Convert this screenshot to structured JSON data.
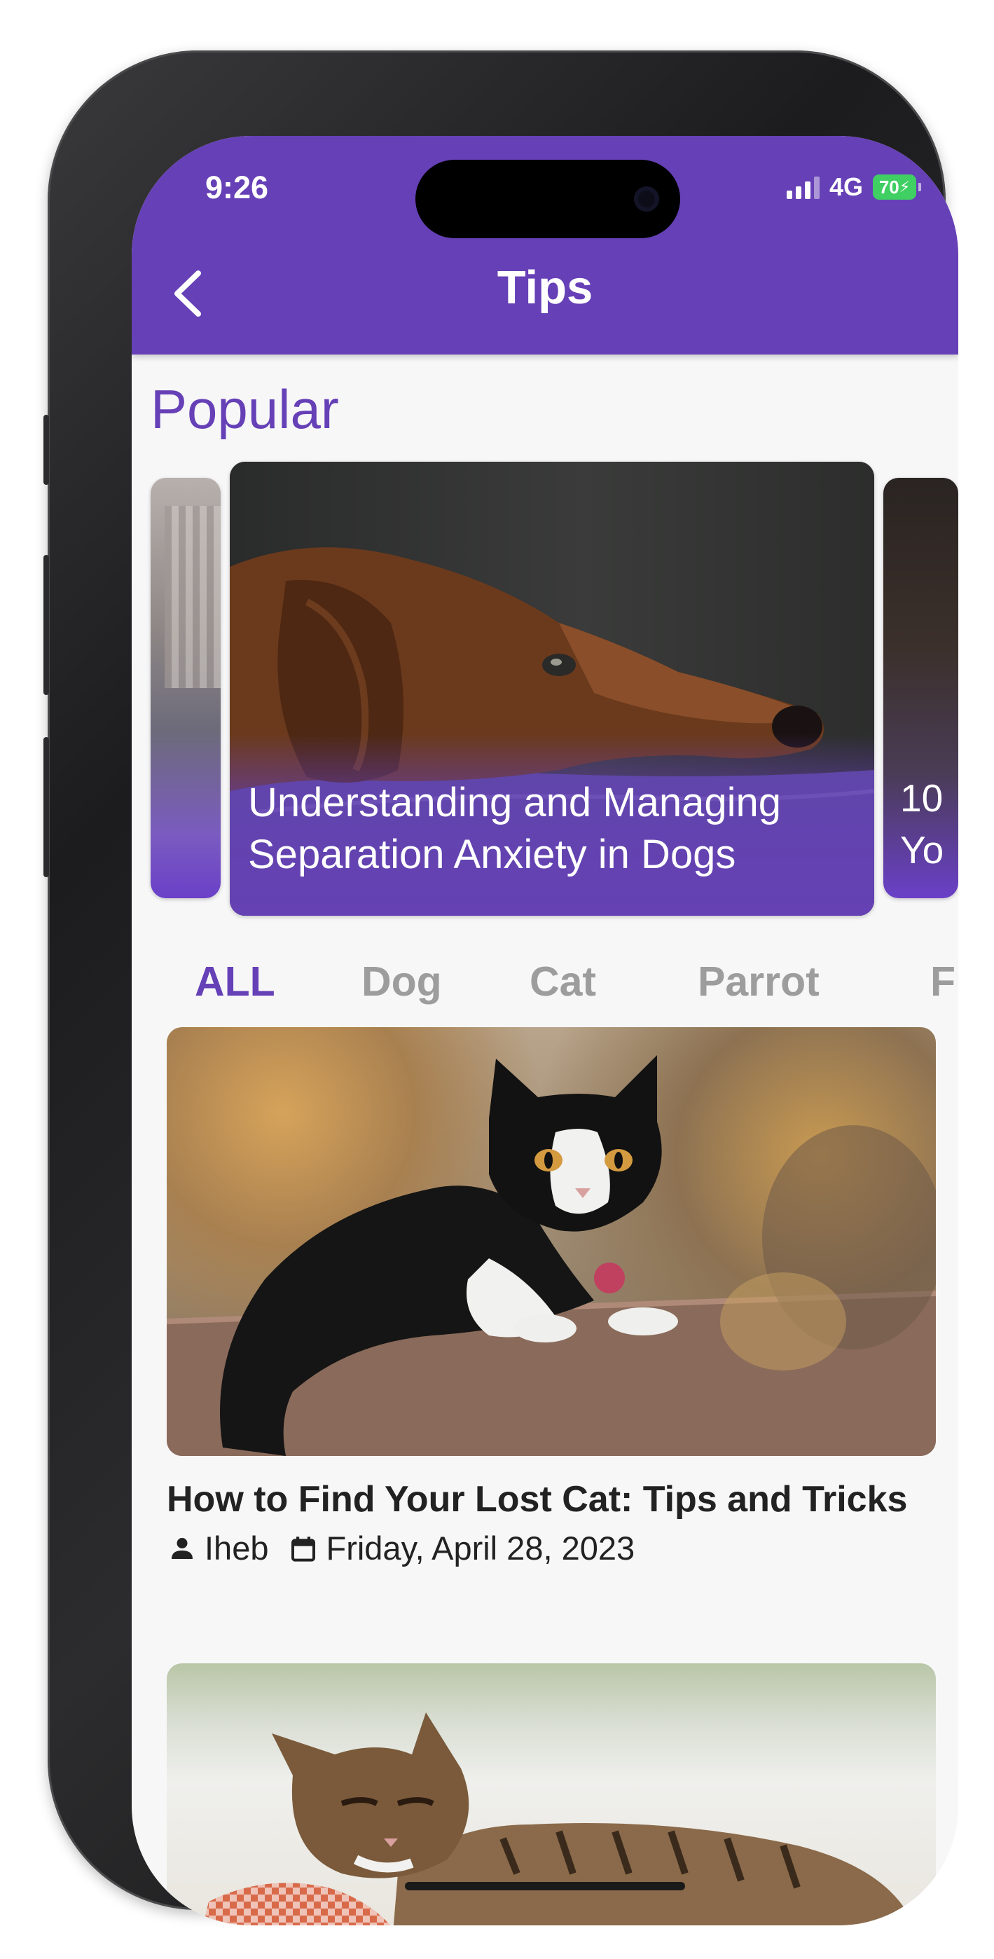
{
  "status_bar": {
    "time": "9:26",
    "network": "4G",
    "battery": "70"
  },
  "app_bar": {
    "title": "Tips",
    "back_icon": "chevron-left-icon",
    "color": "#6640b6"
  },
  "popular": {
    "heading": "Popular",
    "cards": [
      {
        "title": "Understanding and Managing Separation Anxiety in Dogs"
      },
      {
        "title_partial": "10\nYo"
      }
    ]
  },
  "categories": {
    "tabs": [
      "ALL",
      "Dog",
      "Cat",
      "Parrot",
      "Fi"
    ],
    "selected": "ALL"
  },
  "articles": [
    {
      "title": "How to Find Your Lost Cat: Tips and Tricks",
      "author": "Iheb",
      "date": "Friday, April 28, 2023"
    },
    {
      "title": "",
      "author": "",
      "date": ""
    }
  ],
  "colors": {
    "accent": "#6640b6",
    "tab_inactive": "#9d9d9d",
    "text": "#222222"
  }
}
